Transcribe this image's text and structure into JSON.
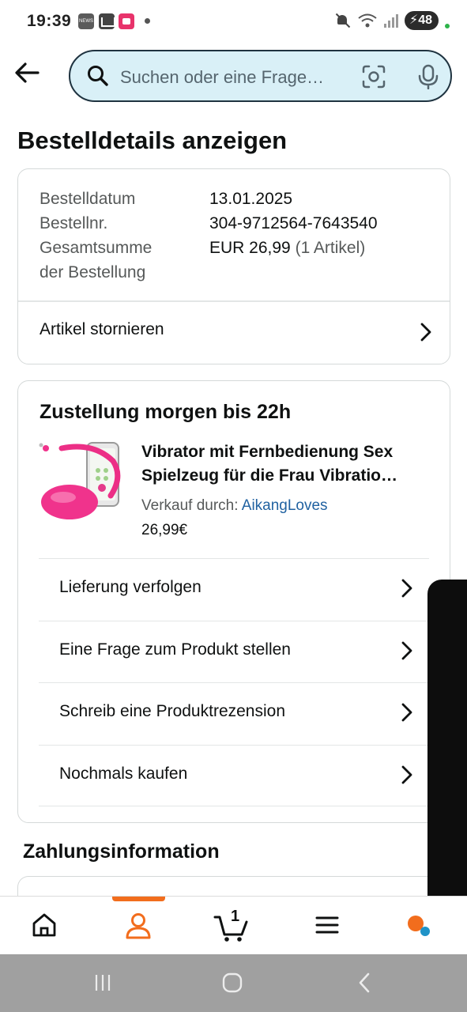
{
  "status_bar": {
    "time": "19:39",
    "battery": "48",
    "news_icon_label": "NEWS"
  },
  "header": {
    "back_icon": "arrow-left-icon",
    "search_placeholder": "Suchen oder eine Frage…"
  },
  "page": {
    "title": "Bestelldetails anzeigen"
  },
  "order_summary": {
    "rows": [
      {
        "label": "Bestelldatum",
        "value": "13.01.2025"
      },
      {
        "label": "Bestellnr.",
        "value": "304-9712564-7643540"
      }
    ],
    "total_label_line1": "Gesamtsumme",
    "total_label_line2": "der Bestellung",
    "total_value": "EUR 26,99",
    "total_items": "(1 Artikel)",
    "cancel_label": "Artikel stornieren"
  },
  "delivery": {
    "title": "Zustellung morgen bis 22h",
    "product": {
      "title_line1": "Vibrator mit Fernbedienung Sex",
      "title_line2": "Spielzeug für die Frau Vibratio…",
      "seller_prefix": "Verkauf durch:",
      "seller_name": "AikangLoves",
      "price": "26,99€"
    },
    "actions": [
      {
        "label": "Lieferung verfolgen"
      },
      {
        "label": "Eine Frage zum Produkt stellen"
      },
      {
        "label": "Schreib eine Produktrezension"
      },
      {
        "label": "Nochmals kaufen"
      }
    ]
  },
  "payment": {
    "title": "Zahlungsinformation"
  },
  "bottom_nav": {
    "cart_count": "1",
    "active": "profile",
    "accent": "#f26d1d"
  },
  "colors": {
    "search_bg": "#d9f0f7",
    "link": "#2162a1",
    "text": "#0f1111",
    "muted": "#565959"
  }
}
